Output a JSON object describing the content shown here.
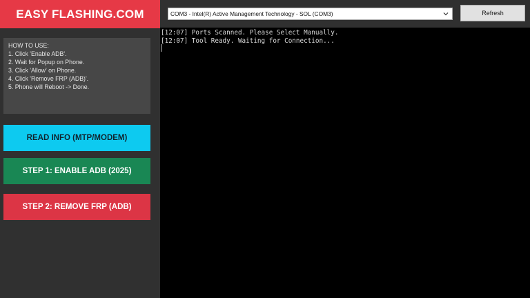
{
  "brand": {
    "title": "EASY FLASHING.COM",
    "bg_color": "#e63946"
  },
  "instructions": {
    "lines": [
      "HOW TO USE:",
      "1. Click 'Enable ADB'.",
      "2. Wait for Popup on Phone.",
      "3. Click 'Allow' on Phone.",
      "4. Click 'Remove FRP (ADB)'.",
      "5. Phone will Reboot -> Done."
    ]
  },
  "buttons": {
    "read_info": {
      "label": "READ INFO (MTP/MODEM)",
      "color": "#0dcaf0"
    },
    "enable_adb": {
      "label": "STEP 1: ENABLE ADB (2025)",
      "color": "#198754"
    },
    "remove_frp": {
      "label": "STEP 2: REMOVE FRP (ADB)",
      "color": "#dc3545"
    }
  },
  "port_select": {
    "selected": "COM3 - Intel(R) Active Management Technology - SOL (COM3)",
    "icon": "chevron-down-icon"
  },
  "refresh": {
    "label": "Refresh"
  },
  "console": {
    "lines": [
      "[12:07] Ports Scanned. Please Select Manually.",
      "[12:07] Tool Ready. Waiting for Connection..."
    ]
  }
}
